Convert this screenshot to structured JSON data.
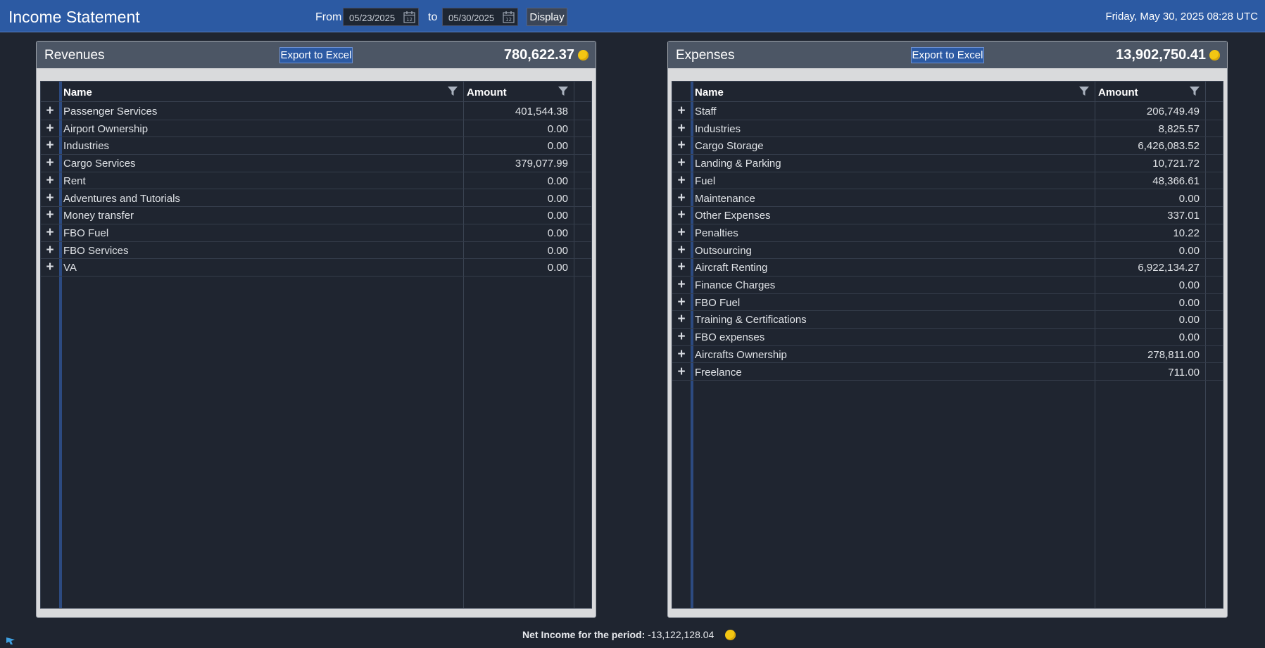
{
  "header": {
    "title": "Income Statement",
    "from_label": "From",
    "from_date": "05/23/2025",
    "to_label": "to",
    "to_date": "05/30/2025",
    "display_label": "Display",
    "datetime": "Friday, May 30, 2025 08:28 UTC"
  },
  "colors": {
    "header_bg": "#2c5aa3",
    "panel_header_bg": "#4c5665",
    "grid_bg": "#1f2530",
    "coin": "#f3c613"
  },
  "revenues": {
    "title": "Revenues",
    "export_label": "Export to Excel",
    "total": "780,622.37",
    "col_name": "Name",
    "col_amount": "Amount",
    "rows": [
      {
        "name": "Passenger Services",
        "amount": "401,544.38"
      },
      {
        "name": "Airport Ownership",
        "amount": "0.00"
      },
      {
        "name": "Industries",
        "amount": "0.00"
      },
      {
        "name": "Cargo Services",
        "amount": "379,077.99"
      },
      {
        "name": "Rent",
        "amount": "0.00"
      },
      {
        "name": "Adventures and Tutorials",
        "amount": "0.00"
      },
      {
        "name": "Money transfer",
        "amount": "0.00"
      },
      {
        "name": "FBO Fuel",
        "amount": "0.00"
      },
      {
        "name": "FBO Services",
        "amount": "0.00"
      },
      {
        "name": "VA",
        "amount": "0.00"
      }
    ]
  },
  "expenses": {
    "title": "Expenses",
    "export_label": "Export to Excel",
    "total": "13,902,750.41",
    "col_name": "Name",
    "col_amount": "Amount",
    "rows": [
      {
        "name": "Staff",
        "amount": "206,749.49"
      },
      {
        "name": "Industries",
        "amount": "8,825.57"
      },
      {
        "name": "Cargo Storage",
        "amount": "6,426,083.52"
      },
      {
        "name": "Landing & Parking",
        "amount": "10,721.72"
      },
      {
        "name": "Fuel",
        "amount": "48,366.61"
      },
      {
        "name": "Maintenance",
        "amount": "0.00"
      },
      {
        "name": "Other Expenses",
        "amount": "337.01"
      },
      {
        "name": "Penalties",
        "amount": "10.22"
      },
      {
        "name": "Outsourcing",
        "amount": "0.00"
      },
      {
        "name": "Aircraft Renting",
        "amount": "6,922,134.27"
      },
      {
        "name": "Finance Charges",
        "amount": "0.00"
      },
      {
        "name": "FBO Fuel",
        "amount": "0.00"
      },
      {
        "name": "Training & Certifications",
        "amount": "0.00"
      },
      {
        "name": "FBO expenses",
        "amount": "0.00"
      },
      {
        "name": "Aircrafts Ownership",
        "amount": "278,811.00"
      },
      {
        "name": "Freelance",
        "amount": "711.00"
      }
    ]
  },
  "footer": {
    "net_label": "Net Income for the period:",
    "net_value": "-13,122,128.04"
  },
  "icons": {
    "date_picker": "calendar-icon",
    "filter": "filter-icon",
    "expand": "plus-icon",
    "currency": "coin-icon"
  }
}
